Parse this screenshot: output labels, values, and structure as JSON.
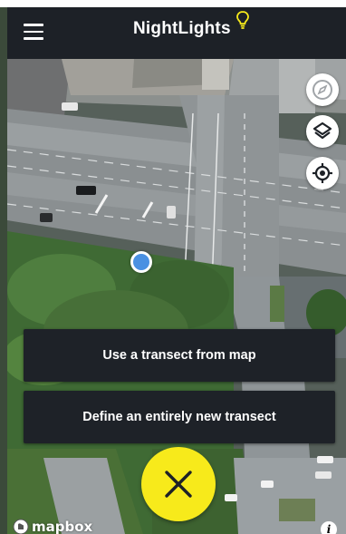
{
  "status_strip": {
    "text": ""
  },
  "appbar": {
    "title": "NightLights",
    "accent_color": "#f7ea1b"
  },
  "map_controls": {
    "compass": "compass-icon",
    "layers": "layers-icon",
    "locate": "locate-icon"
  },
  "actions": {
    "use_transect": "Use a transect from map",
    "define_transect": "Define an entirely new transect"
  },
  "fab": {
    "icon": "close-icon",
    "color": "#f7ea1b"
  },
  "attribution": {
    "logo_text": "mapbox",
    "info_icon": "info-icon"
  },
  "colors": {
    "appbar_bg": "#1d2127",
    "button_bg": "#1e2228",
    "location_dot": "#4a90e2"
  }
}
